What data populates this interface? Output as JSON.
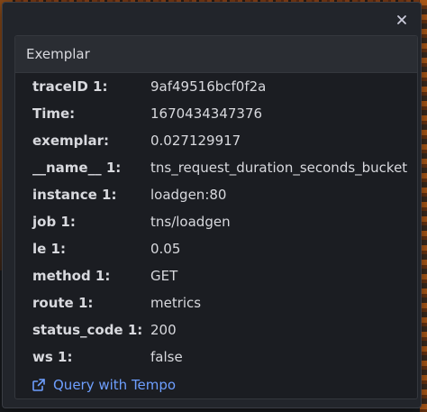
{
  "panel": {
    "title": "Exemplar",
    "close_icon": "close-icon"
  },
  "fields": [
    {
      "key": "traceID 1:",
      "value": "9af49516bcf0f2a"
    },
    {
      "key": "Time:",
      "value": "1670434347376"
    },
    {
      "key": "exemplar:",
      "value": "0.027129917"
    },
    {
      "key": "__name__ 1:",
      "value": "tns_request_duration_seconds_bucket"
    },
    {
      "key": "instance 1:",
      "value": "loadgen:80"
    },
    {
      "key": "job 1:",
      "value": "tns/loadgen"
    },
    {
      "key": "le 1:",
      "value": "0.05"
    },
    {
      "key": "method 1:",
      "value": "GET"
    },
    {
      "key": "route 1:",
      "value": "metrics"
    },
    {
      "key": "status_code 1:",
      "value": "200"
    },
    {
      "key": "ws 1:",
      "value": "false"
    }
  ],
  "link": {
    "label": "Query with Tempo",
    "icon": "external-link-icon"
  },
  "colors": {
    "link": "#6e9fff",
    "text": "#d8d9de"
  }
}
